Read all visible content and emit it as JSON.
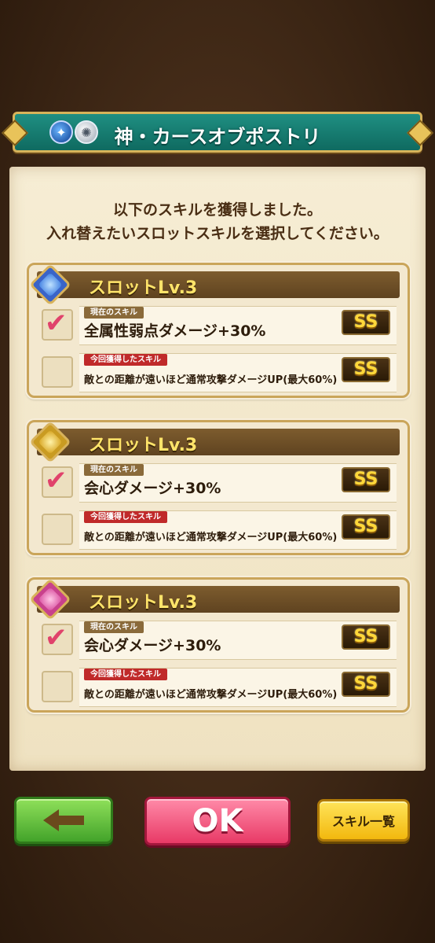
{
  "header": {
    "title": "神・カースオブポストリ",
    "element_icons": [
      "water-icon",
      "light-icon"
    ]
  },
  "intro": {
    "line1": "以下のスキルを獲得しました。",
    "line2": "入れ替えたいスロットスキルを選択してください。"
  },
  "slots": [
    {
      "title": "スロットLv.3",
      "icon_color": "blue",
      "current": {
        "tag": "現在のスキル",
        "name": "全属性弱点ダメージ+30%",
        "rank": "SS",
        "checked": true
      },
      "new": {
        "tag": "今回獲得したスキル",
        "name": "敵との距離が遠いほど通常攻撃ダメージUP(最大60%)",
        "rank": "SS",
        "checked": false
      }
    },
    {
      "title": "スロットLv.3",
      "icon_color": "gold",
      "current": {
        "tag": "現在のスキル",
        "name": "会心ダメージ+30%",
        "rank": "SS",
        "checked": true
      },
      "new": {
        "tag": "今回獲得したスキル",
        "name": "敵との距離が遠いほど通常攻撃ダメージUP(最大60%)",
        "rank": "SS",
        "checked": false
      }
    },
    {
      "title": "スロットLv.3",
      "icon_color": "pink",
      "current": {
        "tag": "現在のスキル",
        "name": "会心ダメージ+30%",
        "rank": "SS",
        "checked": true
      },
      "new": {
        "tag": "今回獲得したスキル",
        "name": "敵との距離が遠いほど通常攻撃ダメージUP(最大60%)",
        "rank": "SS",
        "checked": false
      }
    }
  ],
  "buttons": {
    "back_icon": "left-arrow-icon",
    "ok_label": "OK",
    "skill_list_label": "スキル一覧"
  },
  "colors": {
    "title_bar": "#138075",
    "ok_button": "#e83a66",
    "back_button": "#43a32a",
    "skill_button": "#f2b80e",
    "check_mark": "#e0426b"
  }
}
